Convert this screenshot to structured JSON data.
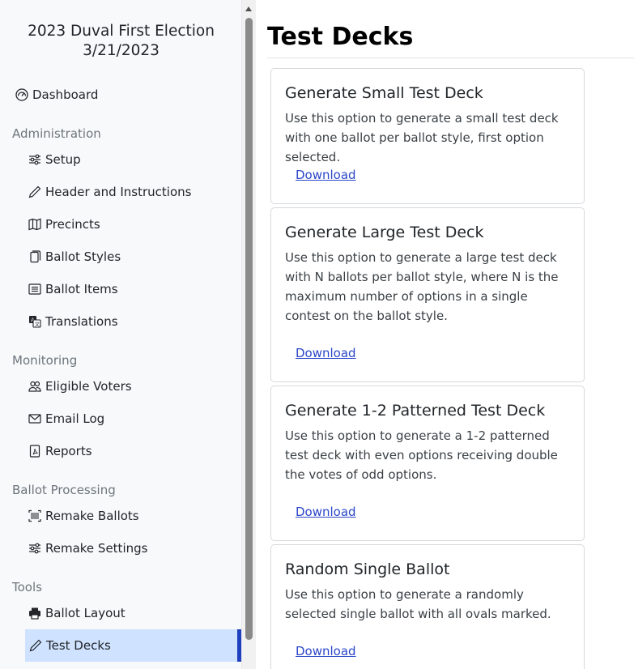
{
  "sidebar": {
    "election_name": "2023 Duval First Election",
    "election_date": "3/21/2023",
    "dashboard": "Dashboard",
    "sections": {
      "administration": "Administration",
      "monitoring": "Monitoring",
      "ballot_processing": "Ballot Processing",
      "tools": "Tools"
    },
    "items": {
      "setup": "Setup",
      "header_instructions": "Header and Instructions",
      "precincts": "Precincts",
      "ballot_styles": "Ballot Styles",
      "ballot_items": "Ballot Items",
      "translations": "Translations",
      "eligible_voters": "Eligible Voters",
      "email_log": "Email Log",
      "reports": "Reports",
      "remake_ballots": "Remake Ballots",
      "remake_settings": "Remake Settings",
      "ballot_layout": "Ballot Layout",
      "test_decks": "Test Decks"
    }
  },
  "main": {
    "title": "Test Decks",
    "cards": [
      {
        "title": "Generate Small Test Deck",
        "description": "Use this option to generate a small test deck with one ballot per ballot style, first option selected.",
        "link": "Download"
      },
      {
        "title": "Generate Large Test Deck",
        "description": "Use this option to generate a large test deck with N ballots per ballot style, where N is the maximum number of options in a single contest on the ballot style.",
        "link": "Download"
      },
      {
        "title": "Generate 1-2 Patterned Test Deck",
        "description": "Use this option to generate a 1-2 patterned test deck with even options receiving double the votes of odd options.",
        "link": "Download"
      },
      {
        "title": "Random Single Ballot",
        "description": "Use this option to generate a randomly selected single ballot with all ovals marked.",
        "link": "Download"
      }
    ]
  },
  "colors": {
    "active_bg": "#cfe2ff",
    "active_bar": "#1f3fbf",
    "link": "#2b47c9",
    "section_label": "#6c757d"
  }
}
